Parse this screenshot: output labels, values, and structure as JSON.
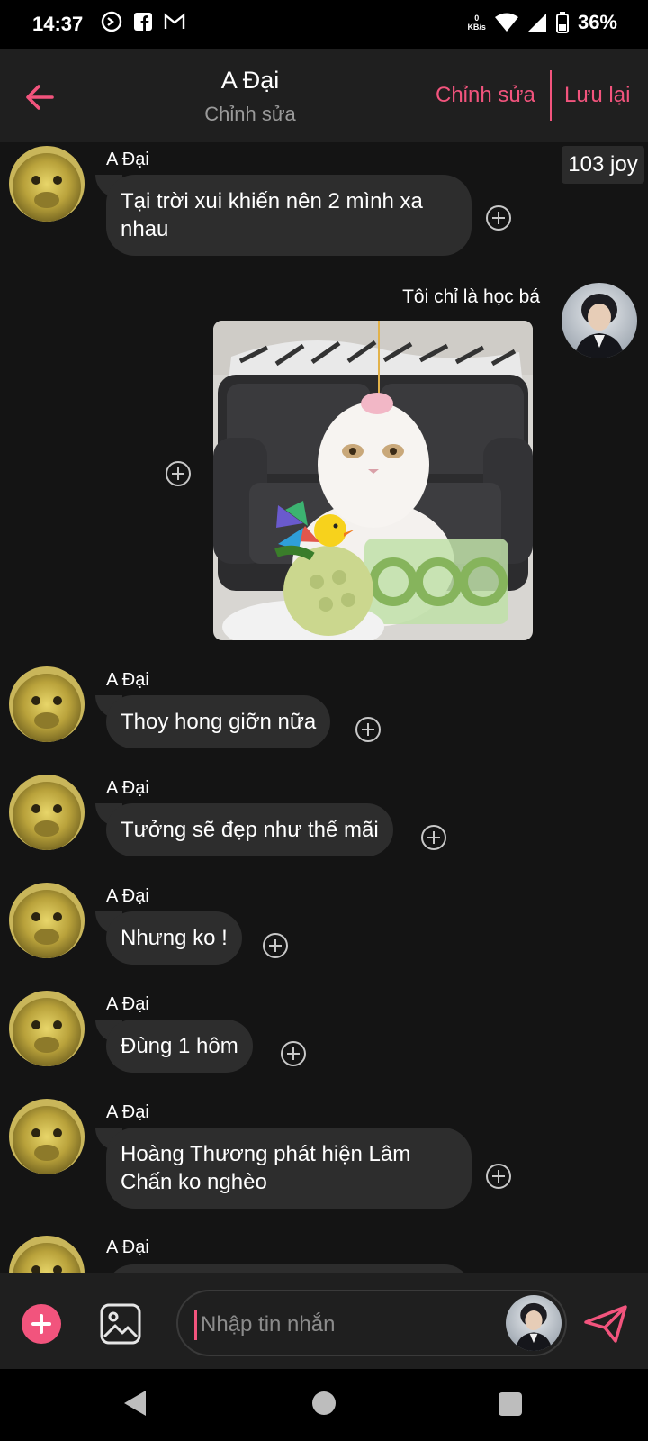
{
  "status_bar": {
    "time": "14:37",
    "net_speed_value": "0",
    "net_speed_unit": "KB/s",
    "battery": "36%"
  },
  "header": {
    "title": "A Đại",
    "subtitle": "Chỉnh sửa",
    "edit_label": "Chỉnh sửa",
    "save_label": "Lưu lại",
    "accent_color": "#f2547d"
  },
  "chat": {
    "joy_badge": "103 joy",
    "my_name": "Tôi chỉ là học bá",
    "messages": [
      {
        "sender": "A Đại",
        "text": "Tại trời xui khiến nên 2 mình xa nhau"
      },
      {
        "sender": "A Đại",
        "text": "Thoy hong giỡn nữa"
      },
      {
        "sender": "A Đại",
        "text": "Tưởng sẽ đẹp như thế mãi"
      },
      {
        "sender": "A Đại",
        "text": "Nhưng ko !"
      },
      {
        "sender": "A Đại",
        "text": "Đùng 1 hôm"
      },
      {
        "sender": "A Đại",
        "text": "Hoàng Thương phát hiện Lâm Chấn ko nghèo"
      },
      {
        "sender": "A Đại",
        "text": ""
      }
    ]
  },
  "input": {
    "placeholder": "Nhập tin nhắn"
  },
  "icons": {
    "back": "arrow-left-icon",
    "add": "plus-circle-icon",
    "image": "image-icon",
    "send": "send-icon",
    "message_action": "plus-circle-outline-icon"
  }
}
